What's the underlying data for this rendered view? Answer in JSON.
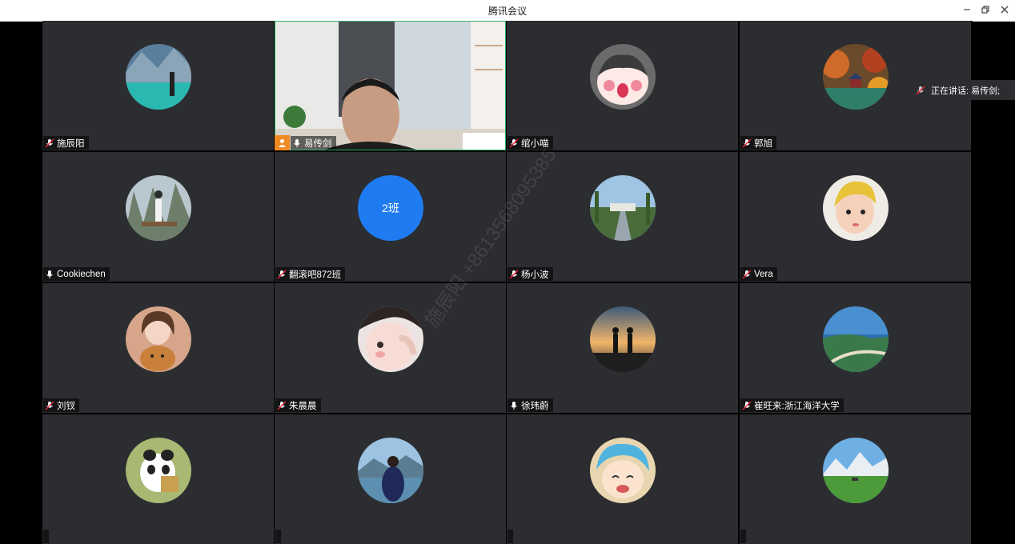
{
  "window": {
    "title": "腾讯会议"
  },
  "speaking": {
    "text": "正在讲话: 易传剑;"
  },
  "watermark": {
    "text": "施辰阳 +8613568095385"
  },
  "participants": [
    {
      "name": "施辰阳"
    },
    {
      "name": "易传剑"
    },
    {
      "name": "绾小喵"
    },
    {
      "name": "郭旭"
    },
    {
      "name": "Cookiechen"
    },
    {
      "name": "翻滚吧872班",
      "avatar_text": "2班"
    },
    {
      "name": "杨小波"
    },
    {
      "name": "Vera"
    },
    {
      "name": "刘钗"
    },
    {
      "name": "朱晨晨"
    },
    {
      "name": "徐玮蔚"
    },
    {
      "name": "崔旺来:浙江海洋大学"
    },
    {
      "name": ""
    },
    {
      "name": ""
    },
    {
      "name": ""
    },
    {
      "name": ""
    }
  ],
  "colors": {
    "accent_active": "#2fb36b",
    "host_badge": "#f08a24",
    "text_avatar": "#1e7bf1",
    "tile_bg": "#2c2d30"
  }
}
